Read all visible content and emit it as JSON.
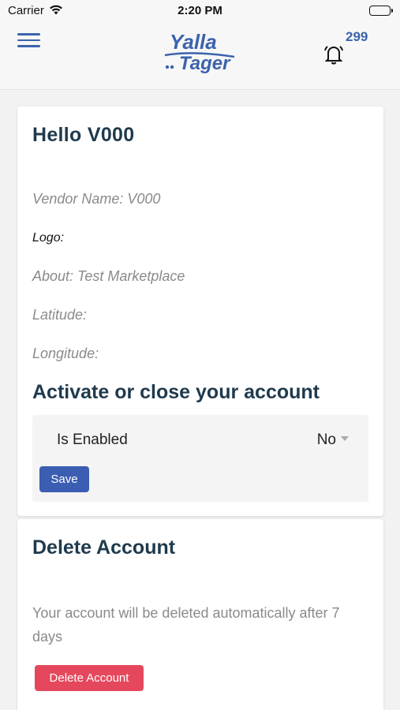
{
  "status_bar": {
    "carrier": "Carrier",
    "time": "2:20 PM"
  },
  "header": {
    "logo_text_top": "Yalla",
    "logo_text_bottom": "Tager",
    "notification_count": "299",
    "brand_color": "#3b63ad",
    "menu_icon": "hamburger-menu-icon",
    "bell_icon": "bell-icon"
  },
  "profile": {
    "greeting": "Hello V000",
    "vendor_name": "Vendor Name: V000",
    "logo_label": "Logo:",
    "about": "About: Test Marketplace",
    "latitude": "Latitude:",
    "longitude": "Longitude:"
  },
  "account_status": {
    "title": "Activate or close your account",
    "label": "Is Enabled",
    "value": "No",
    "save_label": "Save",
    "save_color": "#3b5db2"
  },
  "delete_account": {
    "title": "Delete Account",
    "description": "Your account will be deleted automatically after 7 days",
    "button_label": "Delete Account",
    "button_color": "#e5485d"
  }
}
